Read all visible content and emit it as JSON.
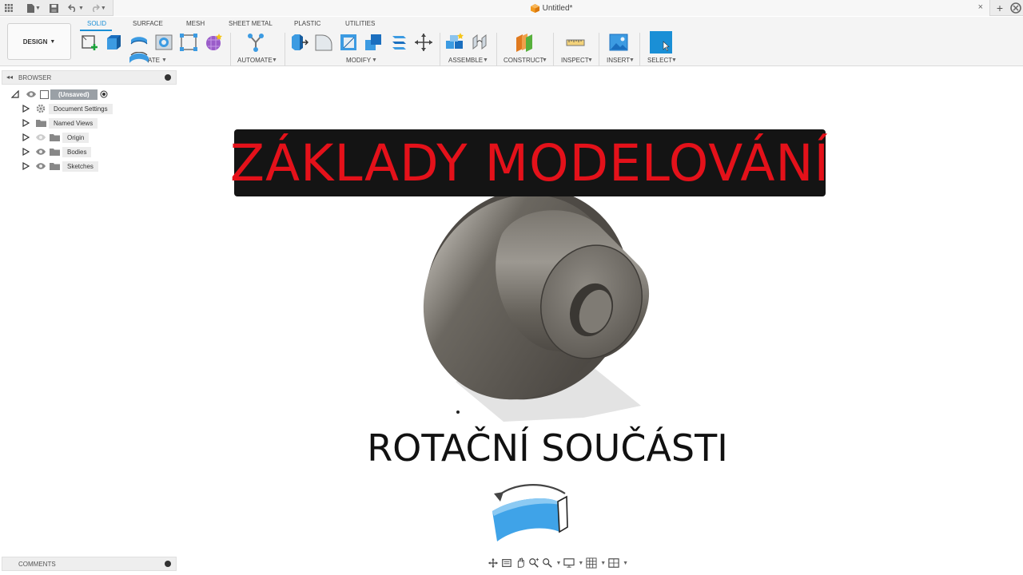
{
  "titlebar": {
    "document_title": "Untitled*",
    "close_glyph": "×",
    "new_tab_glyph": "+"
  },
  "toolbar": {
    "workspace": "DESIGN",
    "tabs": [
      "SOLID",
      "SURFACE",
      "MESH",
      "SHEET METAL",
      "PLASTIC",
      "UTILITIES"
    ],
    "active_tab": "SOLID",
    "groups": [
      "ATE",
      "AUTOMATE",
      "MODIFY",
      "ASSEMBLE",
      "CONSTRUCT",
      "INSPECT",
      "INSERT",
      "SELECT"
    ]
  },
  "browser": {
    "title": "BROWSER",
    "root": "(Unsaved)",
    "items": [
      "Document Settings",
      "Named Views",
      "Origin",
      "Bodies",
      "Sketches"
    ]
  },
  "comments": {
    "title": "COMMENTS"
  },
  "overlay": {
    "headline": "ZÁKLADY MODELOVÁNÍ",
    "subtitle": "ROTAČNÍ SOUČÁSTI"
  },
  "colors": {
    "accent": "#1a8fd6",
    "banner_bg": "#141414",
    "banner_text": "#e4111a",
    "part": "#6e6a63"
  },
  "icons": [
    "apps-icon",
    "file-icon",
    "save-icon",
    "undo-icon",
    "redo-icon",
    "fusion-cube-icon",
    "close-icon",
    "plus-icon",
    "user-icon"
  ]
}
